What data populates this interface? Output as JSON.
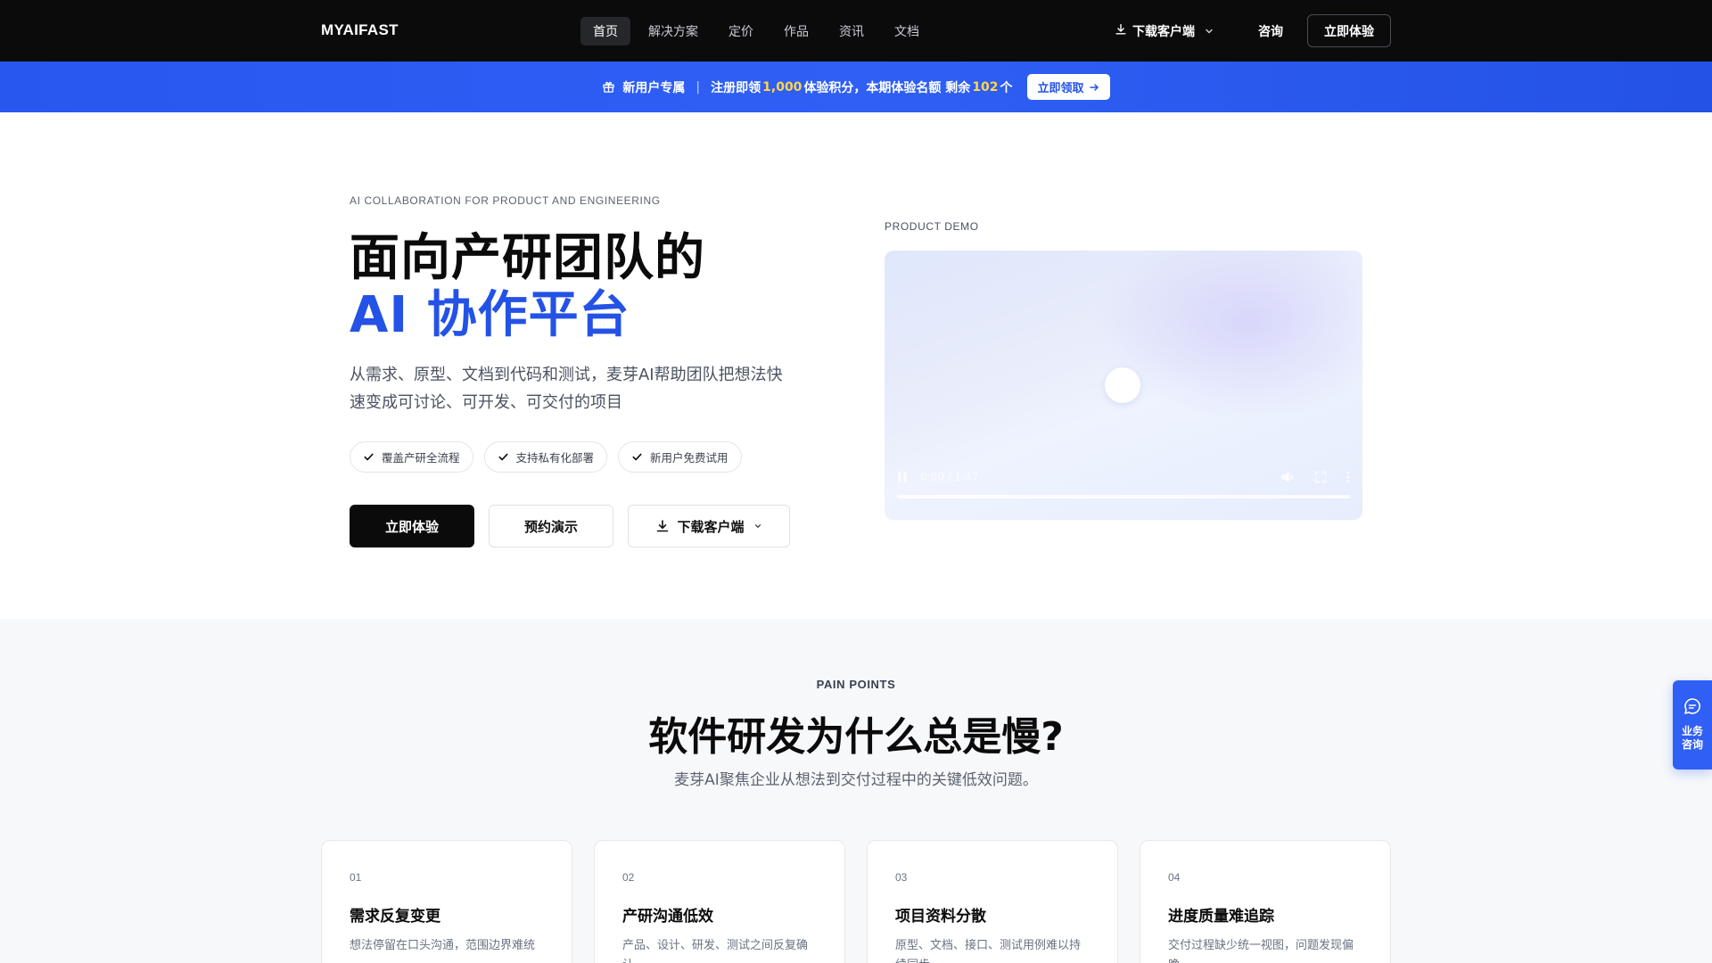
{
  "nav": {
    "logo": "MYAIFAST",
    "items": [
      {
        "label": "首页"
      },
      {
        "label": "解决方案"
      },
      {
        "label": "定价"
      },
      {
        "label": "作品"
      },
      {
        "label": "资讯"
      },
      {
        "label": "文档"
      }
    ],
    "download_label": "下载客户端",
    "consult_label": "咨询",
    "cta_label": "立即体验"
  },
  "promo": {
    "tag": "新用户专属",
    "text_a": "注册即领",
    "points": "1,000",
    "text_b": "体验积分，本期体验名额 剩余",
    "remaining": "102",
    "text_c": "个",
    "button_label": "立即领取"
  },
  "hero": {
    "eyebrow": "AI COLLABORATION FOR PRODUCT AND ENGINEERING",
    "title_line1": "面向产研团队的",
    "title_line2": "AI 协作平台",
    "desc": "从需求、原型、文档到代码和测试，麦芽AI帮助团队把想法快速变成可讨论、可开发、可交付的项目",
    "chips": [
      {
        "label": "覆盖产研全流程"
      },
      {
        "label": "支持私有化部署"
      },
      {
        "label": "新用户免费试用"
      }
    ],
    "btn_primary": "立即体验",
    "btn_demo": "预约演示",
    "btn_download": "下载客户端"
  },
  "demo": {
    "label": "PRODUCT DEMO",
    "time": "0:00 / 1:47"
  },
  "pain": {
    "label": "PAIN POINTS",
    "title": "软件研发为什么总是慢?",
    "subtitle": "麦芽AI聚焦企业从想法到交付过程中的关键低效问题。",
    "cards": [
      {
        "num": "01",
        "title": "需求反复变更",
        "desc": "想法停留在口头沟通，范围边界难统一。"
      },
      {
        "num": "02",
        "title": "产研沟通低效",
        "desc": "产品、设计、研发、测试之间反复确认。"
      },
      {
        "num": "03",
        "title": "项目资料分散",
        "desc": "原型、文档、接口、测试用例难以持续同步。"
      },
      {
        "num": "04",
        "title": "进度质量难追踪",
        "desc": "交付过程缺少统一视图，问题发现偏晚。"
      }
    ]
  },
  "float": {
    "label_line1": "业务",
    "label_line2": "咨询"
  }
}
